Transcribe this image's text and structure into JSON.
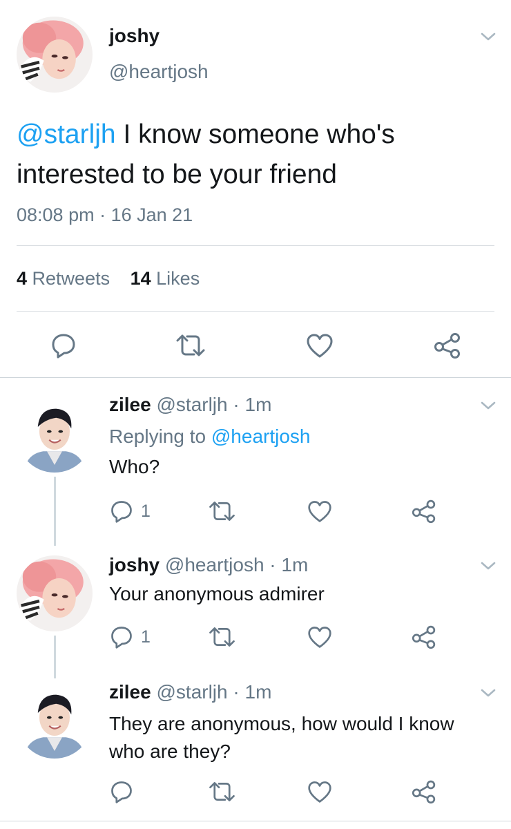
{
  "main_tweet": {
    "display_name": "joshy",
    "handle": "@heartjosh",
    "mention": "@starljh",
    "text_line1": " I know someone who's",
    "text_line2": "interested to be your friend",
    "timestamp": "08:08 pm · 16 Jan 21",
    "retweets_count": "4",
    "retweets_label": " Retweets",
    "likes_count": "14",
    "likes_label": " Likes"
  },
  "replies": [
    {
      "display_name": "zilee",
      "handle": "@starljh",
      "sep": " · ",
      "time": "1m",
      "replying_prefix": "Replying to ",
      "replying_handle": "@heartjosh",
      "text": "Who?",
      "reply_count": "1"
    },
    {
      "display_name": "joshy",
      "handle": "@heartjosh",
      "sep": " · ",
      "time": "1m",
      "text": "Your anonymous admirer",
      "reply_count": "1"
    },
    {
      "display_name": "zilee",
      "handle": "@starljh",
      "sep": " · ",
      "time": "1m",
      "text_line1": "They are anonymous, how would I know",
      "text_line2": "who are they?"
    }
  ],
  "icons": {
    "reply": "reply-icon",
    "retweet": "retweet-icon",
    "like": "heart-icon",
    "share": "share-icon",
    "menu": "chevron-down-icon"
  },
  "colors": {
    "link": "#1da1f2",
    "muted": "#657786",
    "text": "#14171a",
    "divider": "#d9dee2"
  }
}
